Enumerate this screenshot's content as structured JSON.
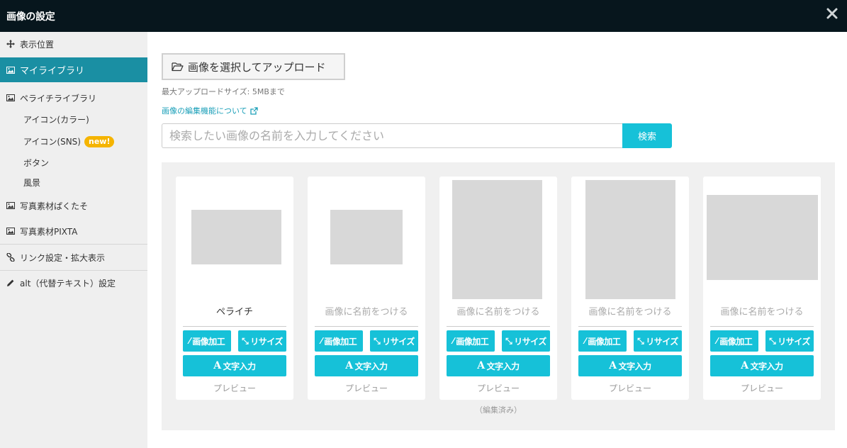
{
  "window": {
    "title": "画像の設定"
  },
  "sidebar": {
    "display_position": "表示位置",
    "my_library": "マイライブラリ",
    "peraichi_library": "ペライチライブラリ",
    "sub_items": [
      "アイコン(カラー)",
      "アイコン(SNS)",
      "ボタン",
      "風景"
    ],
    "new_badge": "new!",
    "pakutaso": "写真素材ぱくたそ",
    "pixta": "写真素材PIXTA",
    "link_settings": "リンク設定・拡大表示",
    "alt_settings": "alt（代替テキスト）設定"
  },
  "main": {
    "upload_label": "画像を選択してアップロード",
    "max_size": "最大アップロードサイズ: 5MBまで",
    "edit_link": "画像の編集機能について",
    "search_placeholder": "検索したい画像の名前を入力してください",
    "search_button": "検索",
    "edited_note": "（編集済み）"
  },
  "cards": [
    {
      "name": "ペライチ",
      "name_filled": true
    },
    {
      "name": "画像に名前をつける",
      "name_filled": false
    },
    {
      "name": "画像に名前をつける",
      "name_filled": false
    },
    {
      "name": "画像に名前をつける",
      "name_filled": false
    },
    {
      "name": "画像に名前をつける",
      "name_filled": false
    }
  ],
  "card_actions": {
    "edit": "画像加工",
    "resize": "リサイズ",
    "text": "文字入力",
    "preview": "プレビュー"
  },
  "colors": {
    "titlebar": "#07161d",
    "accent": "#16c1d8",
    "sidebar_active": "#1a8fa3",
    "badge": "#f5b400"
  }
}
